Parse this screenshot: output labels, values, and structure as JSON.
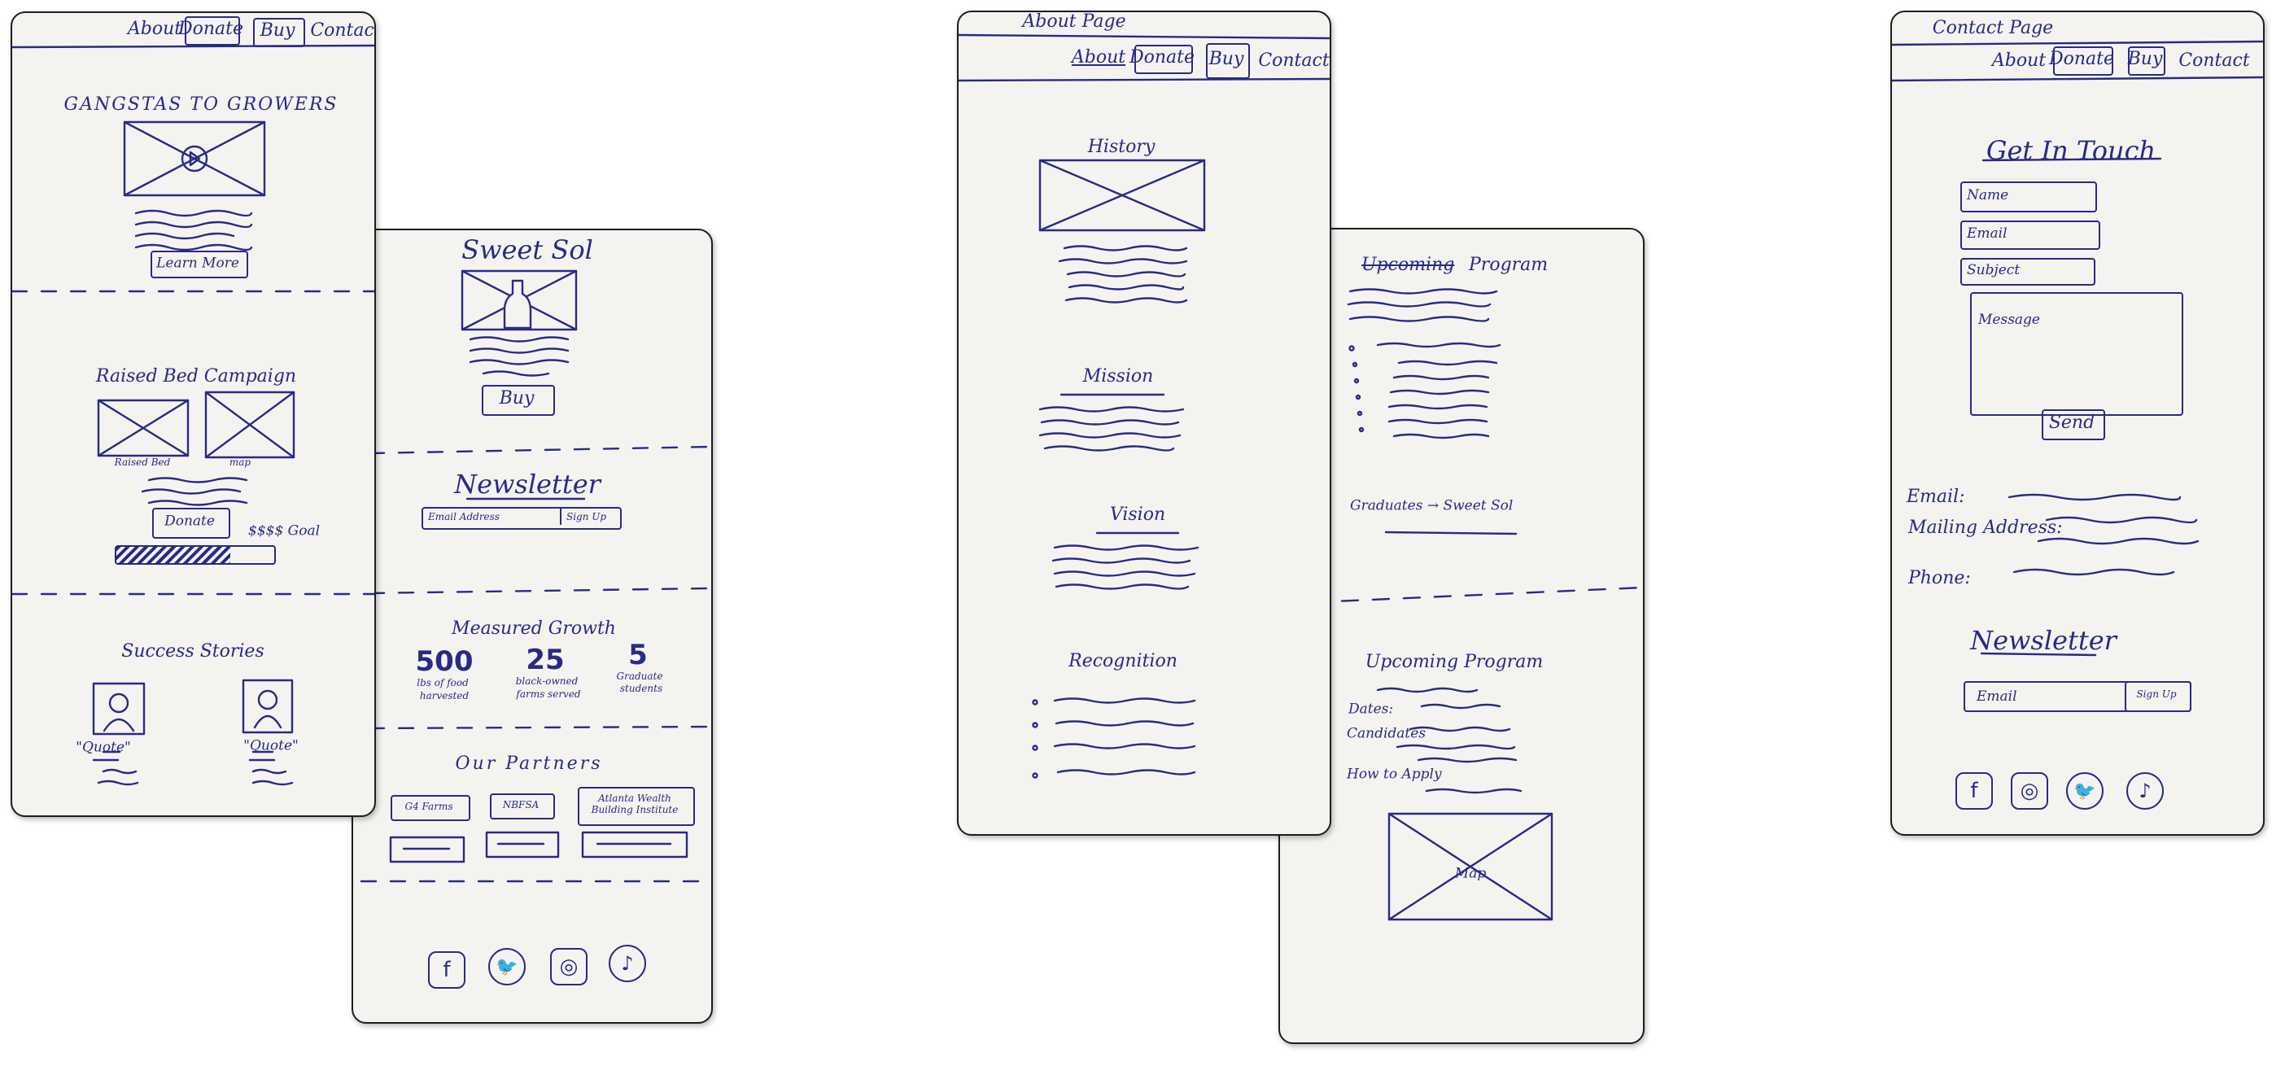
{
  "home": {
    "nav": {
      "about": "About",
      "donate": "Donate",
      "buy": "Buy",
      "contact": "Contact"
    },
    "hero_title": "GANGSTAS TO GROWERS",
    "learn_more": "Learn More",
    "campaign_title": "Raised Bed Campaign",
    "caption_raised_bed": "Raised Bed",
    "caption_map": "map",
    "donate_button": "Donate",
    "goal_label": "$$$$ Goal",
    "goal_progress": 0.72,
    "success_title": "Success Stories",
    "quote_1": "\"Quote\"",
    "quote_2": "\"Quote\""
  },
  "home_continued": {
    "product_title": "Sweet Sol",
    "buy_button": "Buy",
    "newsletter_title": "Newsletter",
    "email_placeholder": "Email Address",
    "signup_button": "Sign Up",
    "growth_title": "Measured Growth",
    "stats": [
      {
        "value": "500",
        "label_1": "lbs of food",
        "label_2": "harvested"
      },
      {
        "value": "25",
        "label_1": "black-owned",
        "label_2": "farms served"
      },
      {
        "value": "5",
        "label_1": "Graduate",
        "label_2": "students"
      }
    ],
    "partners_title": "Our Partners",
    "partners": [
      "G4 Farms",
      "NBFSA",
      "Atlanta Wealth Building Institute"
    ],
    "social_icons": [
      "facebook-icon",
      "twitter-icon",
      "instagram-icon",
      "tiktok-icon"
    ]
  },
  "about": {
    "page_label": "About Page",
    "nav": {
      "about": "About",
      "donate": "Donate",
      "buy": "Buy",
      "contact": "Contact"
    },
    "history": "History",
    "mission": "Mission",
    "vision": "Vision",
    "recognition": "Recognition"
  },
  "about_continued": {
    "program_prefix": "Upcoming",
    "program_word": "Program",
    "graduates": "Graduates → Sweet Sol",
    "upcoming_title": "Upcoming Program",
    "dates_label": "Dates:",
    "candidates_label": "Candidates",
    "apply_label": "How to Apply",
    "map_label": "Map"
  },
  "contact": {
    "page_label": "Contact Page",
    "nav": {
      "about": "About",
      "donate": "Donate",
      "buy": "Buy",
      "contact": "Contact"
    },
    "heading": "Get In Touch",
    "name_placeholder": "Name",
    "email_placeholder": "Email",
    "subject_placeholder": "Subject",
    "message_placeholder": "Message",
    "send_button": "Send",
    "email_label": "Email:",
    "mailing_label": "Mailing Address:",
    "phone_label": "Phone:",
    "newsletter_title": "Newsletter",
    "newsletter_email": "Email",
    "signup_button": "Sign Up",
    "social_icons": [
      "facebook-icon",
      "instagram-icon",
      "twitter-icon",
      "tiktok-icon"
    ]
  }
}
